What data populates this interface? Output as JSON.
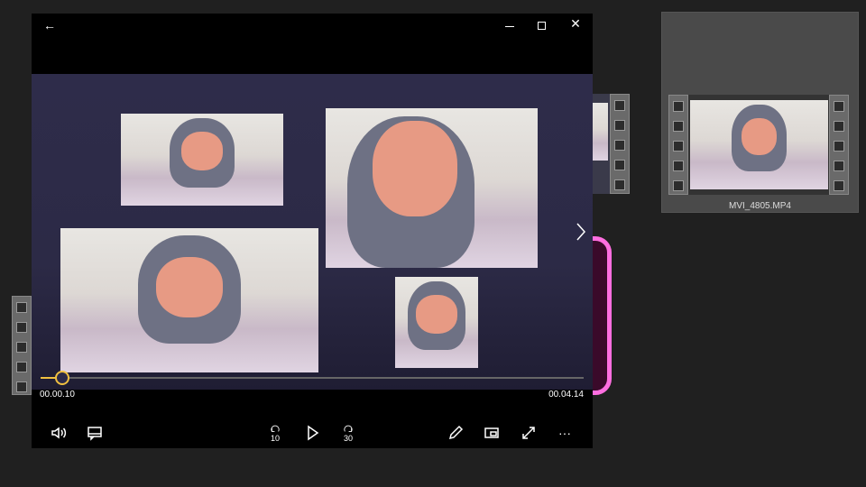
{
  "player": {
    "current_time": "00.00.10",
    "total_time": "00.04.14",
    "progress_fraction": 0.04,
    "skip_back_label": "10",
    "skip_forward_label": "30",
    "more_label": "···"
  },
  "library": {
    "items": [
      {
        "filename": "MVI_4805.MP4"
      }
    ]
  },
  "colors": {
    "accent": "#f0c040",
    "highlight_frame": "#ff6ee0",
    "video_bg": "#2c2a48"
  }
}
